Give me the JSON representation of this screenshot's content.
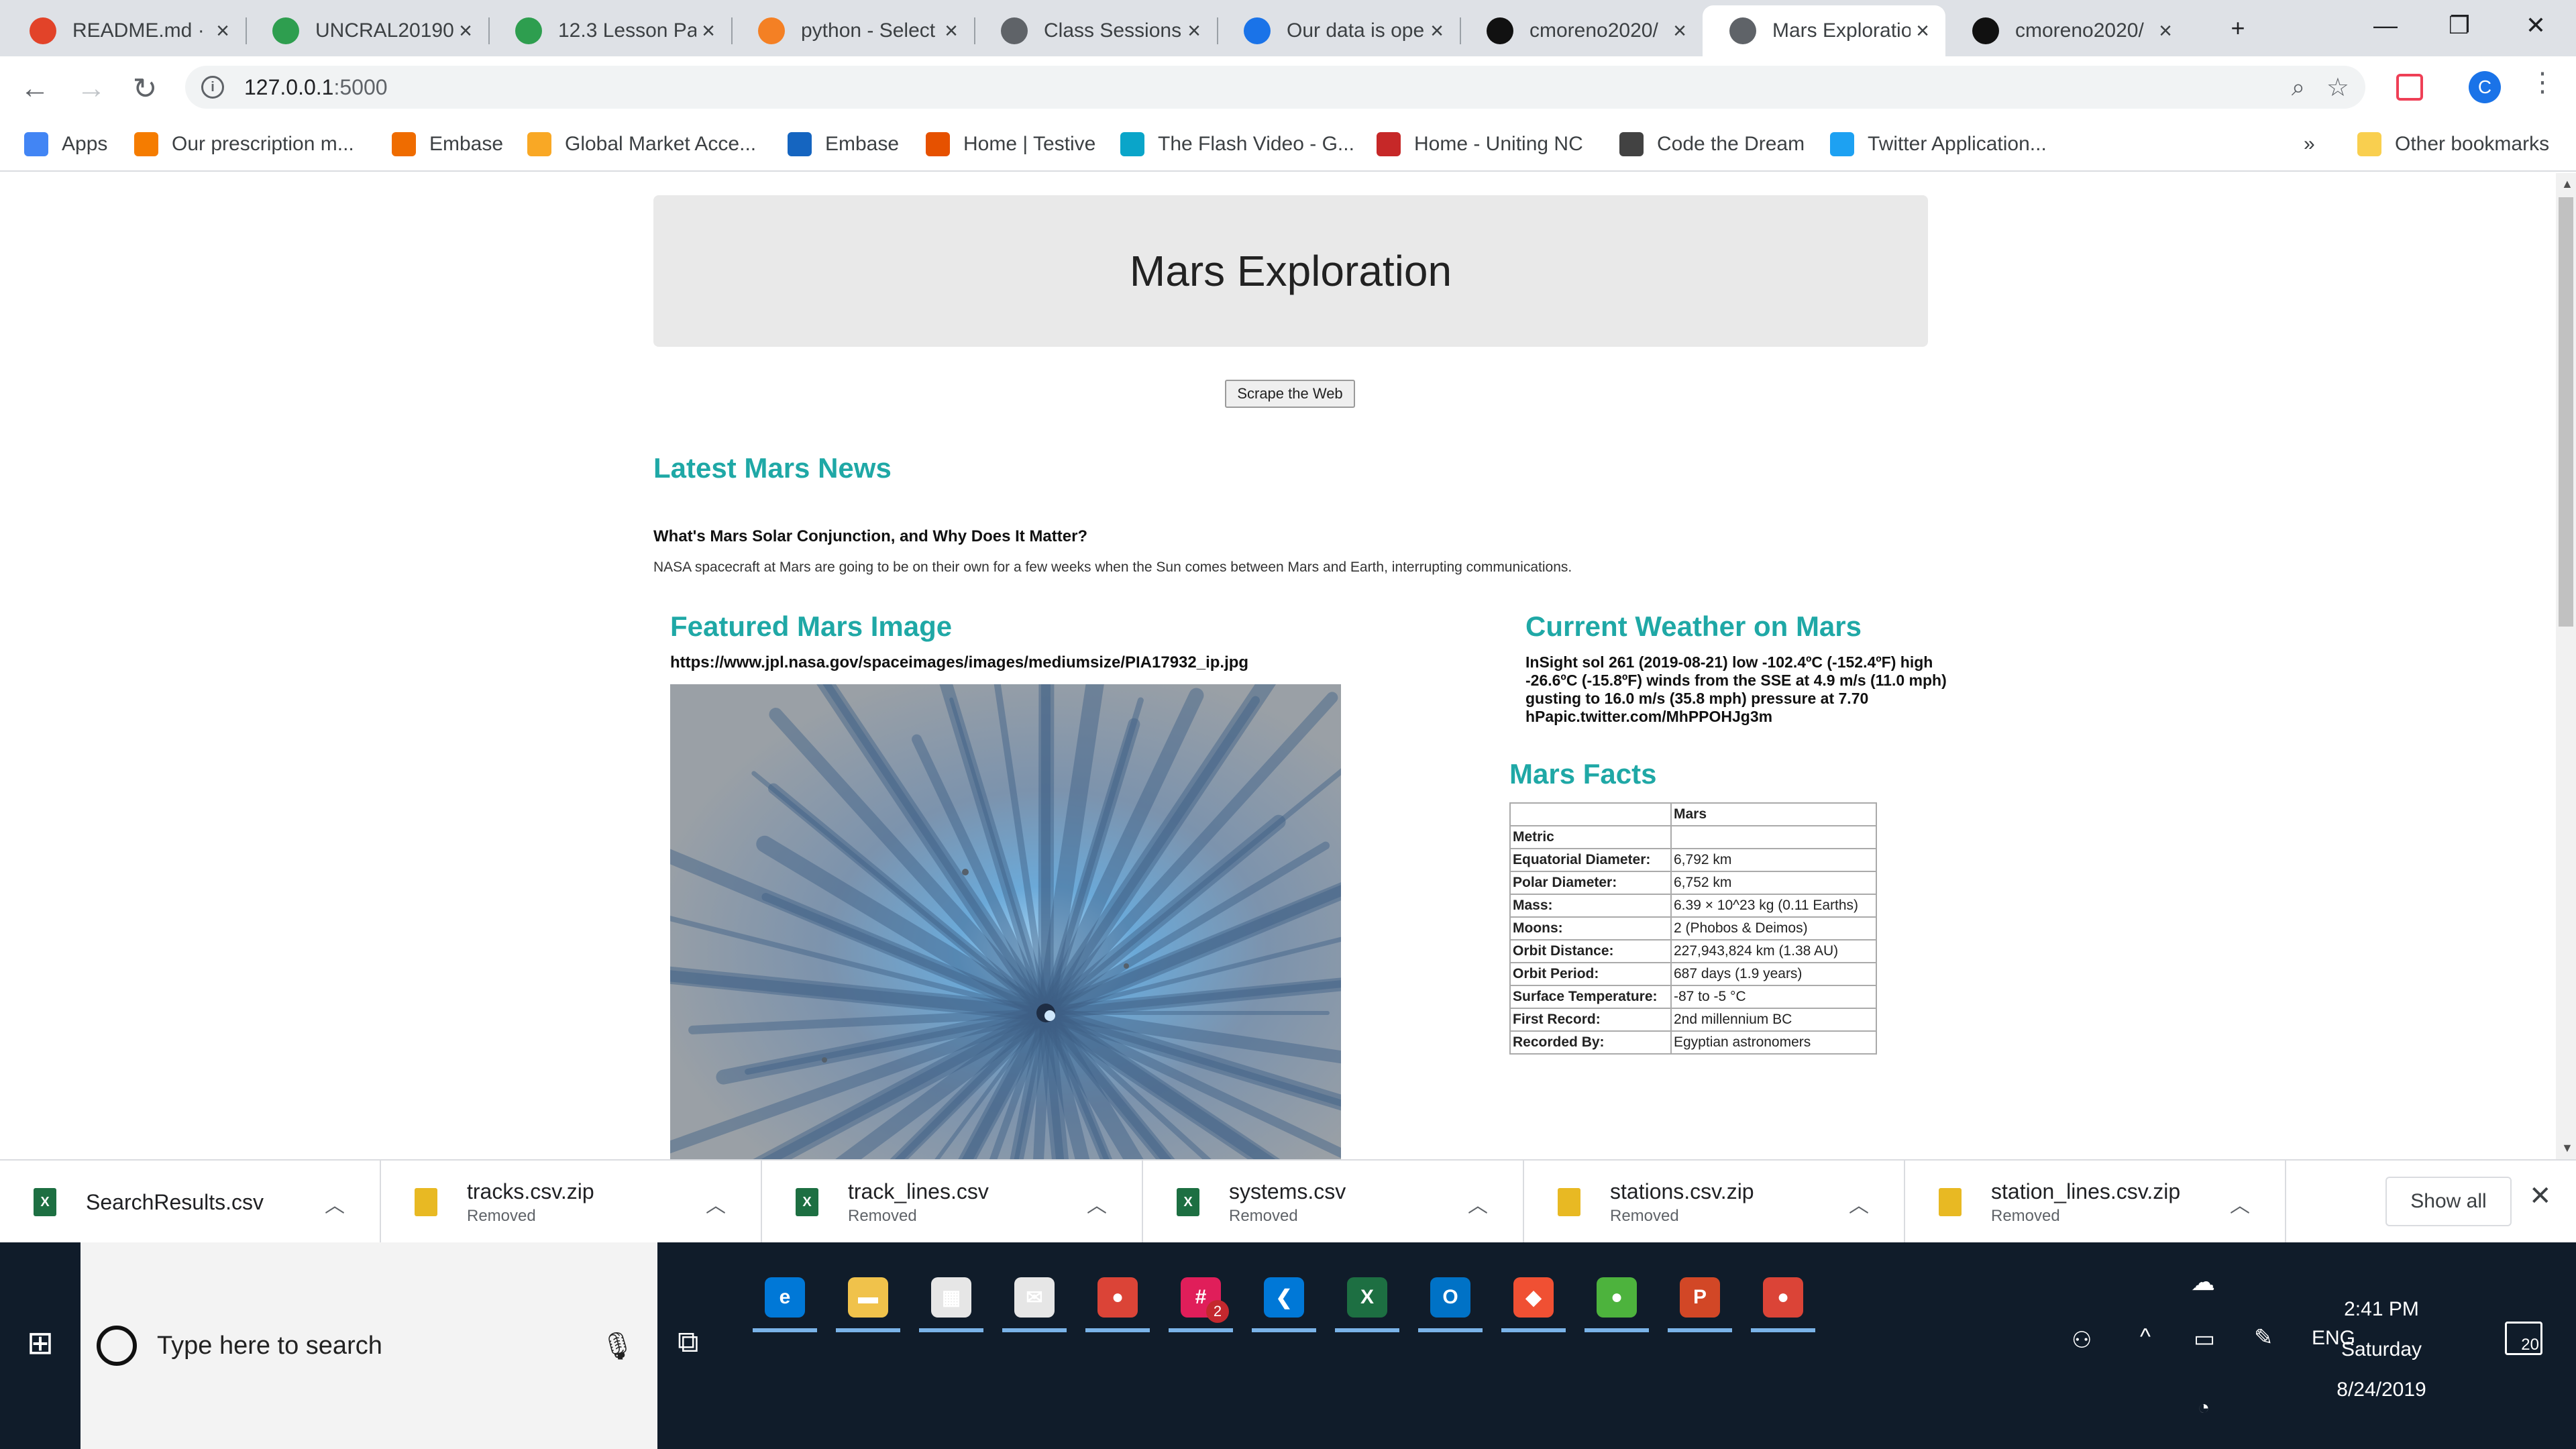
{
  "browser": {
    "tabs": [
      {
        "title": "README.md · m",
        "icon": "gitlab-icon",
        "color": "#e24329"
      },
      {
        "title": "UNCRAL20190",
        "icon": "recycle-icon",
        "color": "#2e9e4f"
      },
      {
        "title": "12.3 Lesson Pa",
        "icon": "recycle-icon",
        "color": "#2e9e4f"
      },
      {
        "title": "python - Select",
        "icon": "stackoverflow-icon",
        "color": "#f48024"
      },
      {
        "title": "Class Sessions",
        "icon": "globe-icon",
        "color": "#5f6368"
      },
      {
        "title": "Our data is ope",
        "icon": "peace-icon",
        "color": "#1a73e8"
      },
      {
        "title": "cmoreno2020/",
        "icon": "github-icon",
        "color": "#111111"
      },
      {
        "title": "Mars Exploratio",
        "icon": "globe-icon",
        "color": "#5f6368"
      },
      {
        "title": "cmoreno2020/",
        "icon": "github-icon",
        "color": "#111111"
      }
    ],
    "url_host": "127.0.0.1",
    "url_port": ":5000",
    "avatar_letter": "C",
    "bookmarks": [
      {
        "label": "Apps",
        "color": "#4285f4"
      },
      {
        "label": "Our prescription m...",
        "color": "#f57c00"
      },
      {
        "label": "Embase",
        "color": "#ef6c00"
      },
      {
        "label": "Global Market Acce...",
        "color": "#f9a825"
      },
      {
        "label": "Embase",
        "color": "#1565c0"
      },
      {
        "label": "Home | Testive",
        "color": "#e65100"
      },
      {
        "label": "The Flash Video - G...",
        "color": "#0aa5c9"
      },
      {
        "label": "Home - Uniting NC",
        "color": "#c62828"
      },
      {
        "label": "Code the Dream",
        "color": "#424242"
      },
      {
        "label": "Twitter Application...",
        "color": "#1da1f2"
      }
    ],
    "bookmarks_overflow": "»",
    "other_bookmarks": "Other bookmarks"
  },
  "page": {
    "title": "Mars Exploration",
    "scrape_button": "Scrape the Web",
    "news_heading": "Latest Mars News",
    "news_title": "What's Mars Solar Conjunction, and Why Does It Matter?",
    "news_paragraph": "NASA spacecraft at Mars are going to be on their own for a few weeks when the Sun comes between Mars and Earth, interrupting communications.",
    "image_heading": "Featured Mars Image",
    "image_url": "https://www.jpl.nasa.gov/spaceimages/images/mediumsize/PIA17932_ip.jpg",
    "weather_heading": "Current Weather on Mars",
    "weather_text": "InSight sol 261 (2019-08-21) low -102.4ºC (-152.4ºF) high -26.6ºC (-15.8ºF) winds from the SSE at 4.9 m/s (11.0 mph) gusting to 16.0 m/s (35.8 mph) pressure at 7.70 hPapic.twitter.com/MhPPOHJg3m",
    "facts_heading": "Mars Facts",
    "facts_column": "Mars",
    "facts_index_label": "Metric",
    "facts": [
      {
        "k": "Equatorial Diameter:",
        "v": "6,792 km"
      },
      {
        "k": "Polar Diameter:",
        "v": "6,752 km"
      },
      {
        "k": "Mass:",
        "v": "6.39 × 10^23 kg (0.11 Earths)"
      },
      {
        "k": "Moons:",
        "v": "2 (Phobos & Deimos)"
      },
      {
        "k": "Orbit Distance:",
        "v": "227,943,824 km (1.38 AU)"
      },
      {
        "k": "Orbit Period:",
        "v": "687 days (1.9 years)"
      },
      {
        "k": "Surface Temperature:",
        "v": "-87 to -5 °C"
      },
      {
        "k": "First Record:",
        "v": "2nd millennium BC"
      },
      {
        "k": "Recorded By:",
        "v": "Egyptian astronomers"
      }
    ]
  },
  "downloads": [
    {
      "name": "SearchResults.csv",
      "status": "",
      "icon": "excel-file-icon",
      "color": "#1d6f42"
    },
    {
      "name": "tracks.csv.zip",
      "status": "Removed",
      "icon": "zip-file-icon",
      "color": "#e8b923"
    },
    {
      "name": "track_lines.csv",
      "status": "Removed",
      "icon": "excel-file-icon",
      "color": "#1d6f42"
    },
    {
      "name": "systems.csv",
      "status": "Removed",
      "icon": "excel-file-icon",
      "color": "#1d6f42"
    },
    {
      "name": "stations.csv.zip",
      "status": "Removed",
      "icon": "zip-file-icon",
      "color": "#e8b923"
    },
    {
      "name": "station_lines.csv.zip",
      "status": "Removed",
      "icon": "zip-file-icon",
      "color": "#e8b923"
    }
  ],
  "downloads_show_all": "Show all",
  "taskbar": {
    "search_placeholder": "Type here to search",
    "apps": [
      {
        "name": "edge-icon",
        "glyph": "e",
        "color": "#0078d7"
      },
      {
        "name": "file-explorer-icon",
        "glyph": "▬",
        "color": "#f0c24b"
      },
      {
        "name": "store-icon",
        "glyph": "▦",
        "color": "#e6e6e6"
      },
      {
        "name": "mail-icon",
        "glyph": "✉",
        "color": "#e6e6e6"
      },
      {
        "name": "chrome-icon",
        "glyph": "●",
        "color": "#db4437"
      },
      {
        "name": "slack-icon",
        "glyph": "#",
        "color": "#e01e5a"
      },
      {
        "name": "vscode-icon",
        "glyph": "❮",
        "color": "#0078d7"
      },
      {
        "name": "excel-icon",
        "glyph": "X",
        "color": "#1d6f42"
      },
      {
        "name": "outlook-icon",
        "glyph": "O",
        "color": "#0072c6"
      },
      {
        "name": "git-icon",
        "glyph": "◆",
        "color": "#f05033"
      },
      {
        "name": "mongodb-icon",
        "glyph": "●",
        "color": "#4db33d"
      },
      {
        "name": "powerpoint-icon",
        "glyph": "P",
        "color": "#d24726"
      },
      {
        "name": "chrome-icon-2",
        "glyph": "●",
        "color": "#db4437"
      }
    ],
    "slack_badge": "2",
    "language": "ENG",
    "time": "2:41 PM",
    "day": "Saturday",
    "date": "8/24/2019",
    "notifications": "20"
  }
}
